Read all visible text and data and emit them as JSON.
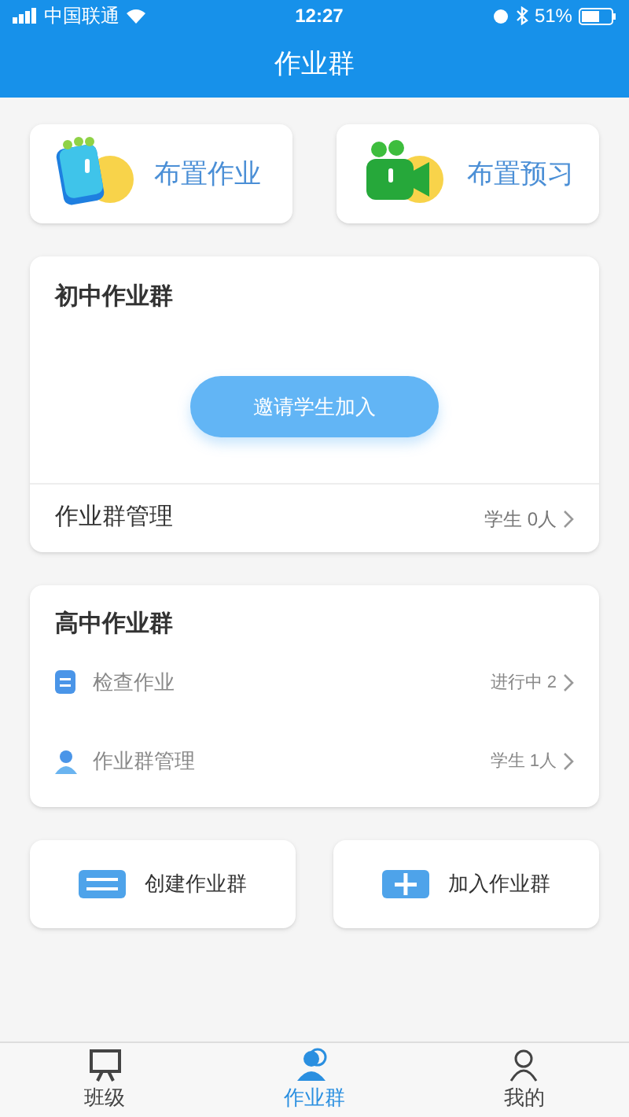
{
  "status_bar": {
    "carrier": "中国联通",
    "time": "12:27",
    "battery": "51%"
  },
  "header": {
    "title": "作业群"
  },
  "quick_actions": [
    {
      "kind": "homework",
      "label": "布置作业"
    },
    {
      "kind": "preview",
      "label": "布置预习"
    }
  ],
  "junior_group": {
    "title": "初中作业群",
    "invite_button": "邀请学生加入",
    "manage_label": "作业群管理",
    "manage_value": "学生 0人"
  },
  "senior_group": {
    "title": "高中作业群",
    "rows": [
      {
        "kind": "check",
        "label": "检查作业",
        "value": "进行中 2"
      },
      {
        "kind": "manage",
        "label": "作业群管理",
        "value": "学生 1人"
      }
    ]
  },
  "group_actions": [
    {
      "kind": "create",
      "label": "创建作业群"
    },
    {
      "kind": "join",
      "label": "加入作业群"
    }
  ],
  "tab_bar": [
    {
      "kind": "class",
      "label": "班级",
      "selected": false
    },
    {
      "kind": "group",
      "label": "作业群",
      "selected": true
    },
    {
      "kind": "me",
      "label": "我的",
      "selected": false
    }
  ]
}
